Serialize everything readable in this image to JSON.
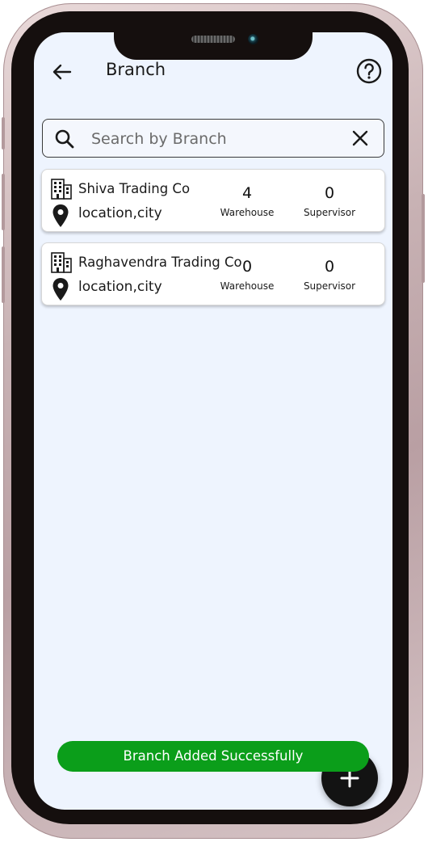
{
  "header": {
    "title": "Branch",
    "back_icon": "arrow-left-icon",
    "help_icon": "help-circle-icon"
  },
  "search": {
    "placeholder": "Search by Branch",
    "value": "",
    "search_icon": "search-icon",
    "clear_icon": "close-icon"
  },
  "branches": [
    {
      "name": "Shiva Trading Co",
      "location": "location,city",
      "warehouse_count": "4",
      "warehouse_label": "Warehouse",
      "supervisor_count": "0",
      "supervisor_label": "Supervisor"
    },
    {
      "name": "Raghavendra Trading Co",
      "location": "location,city",
      "warehouse_count": "0",
      "warehouse_label": "Warehouse",
      "supervisor_count": "0",
      "supervisor_label": "Supervisor"
    }
  ],
  "toast": {
    "message": "Branch Added Successfully",
    "color": "#0b9e1a"
  },
  "fab": {
    "icon": "plus-icon"
  },
  "colors": {
    "screen_background": "#eef4fe",
    "fab_background": "#131313",
    "card_background": "#ffffff"
  }
}
